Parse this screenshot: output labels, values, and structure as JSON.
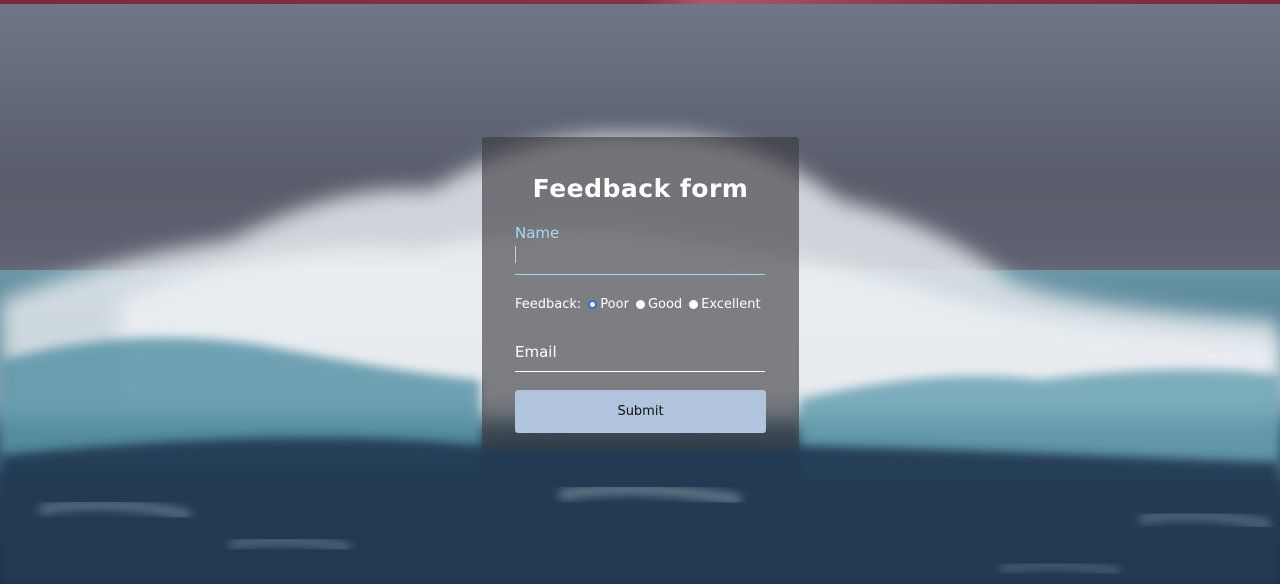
{
  "form": {
    "title": "Feedback form",
    "name_label": "Name",
    "name_value": "",
    "feedback_label": "Feedback:",
    "feedback_options": [
      "Poor",
      "Good",
      "Excellent"
    ],
    "feedback_selected": "Poor",
    "email_placeholder": "Email",
    "submit_label": "Submit"
  },
  "colors": {
    "accent_strip": "#8a3044",
    "card_background": "rgba(58,58,62,0.62)",
    "name_underline": "#a9d9f0",
    "button_background": "#b0c4de",
    "radio_checked": "#2a6fdb"
  },
  "background": {
    "description_icon": "ocean-waves-image"
  }
}
